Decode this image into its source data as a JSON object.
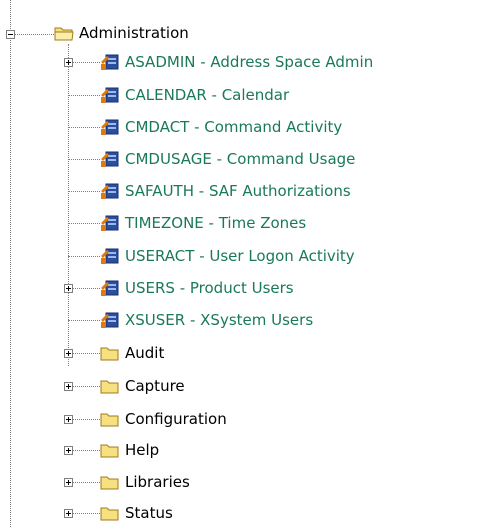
{
  "colors": {
    "report_text": "#1a7a55",
    "folder_text": "#000000",
    "folder_fill": "#f7e07f",
    "report_icon": "#2a4f9e",
    "report_accent": "#e07a10",
    "dotted_line": "#7f7f7f"
  },
  "tree": {
    "root": {
      "label": "Administration",
      "icon": "folder-open-icon",
      "expanded": true,
      "children": [
        {
          "label": "ASADMIN - Address Space Admin",
          "icon": "report-icon",
          "has_children": true
        },
        {
          "label": "CALENDAR - Calendar",
          "icon": "report-icon",
          "has_children": false
        },
        {
          "label": "CMDACT - Command Activity",
          "icon": "report-icon",
          "has_children": false
        },
        {
          "label": "CMDUSAGE - Command Usage",
          "icon": "report-icon",
          "has_children": false
        },
        {
          "label": "SAFAUTH - SAF Authorizations",
          "icon": "report-icon",
          "has_children": false
        },
        {
          "label": "TIMEZONE - Time Zones",
          "icon": "report-icon",
          "has_children": false
        },
        {
          "label": "USERACT - User Logon Activity",
          "icon": "report-icon",
          "has_children": false
        },
        {
          "label": "USERS - Product Users",
          "icon": "report-icon",
          "has_children": true
        },
        {
          "label": "XSUSER - XSystem Users",
          "icon": "report-icon",
          "has_children": false
        }
      ]
    },
    "folders": [
      {
        "label": "Audit",
        "icon": "folder-icon"
      },
      {
        "label": "Capture",
        "icon": "folder-icon"
      },
      {
        "label": "Configuration",
        "icon": "folder-icon"
      },
      {
        "label": "Help",
        "icon": "folder-icon"
      },
      {
        "label": "Libraries",
        "icon": "folder-icon"
      },
      {
        "label": "Status",
        "icon": "folder-icon"
      }
    ]
  }
}
